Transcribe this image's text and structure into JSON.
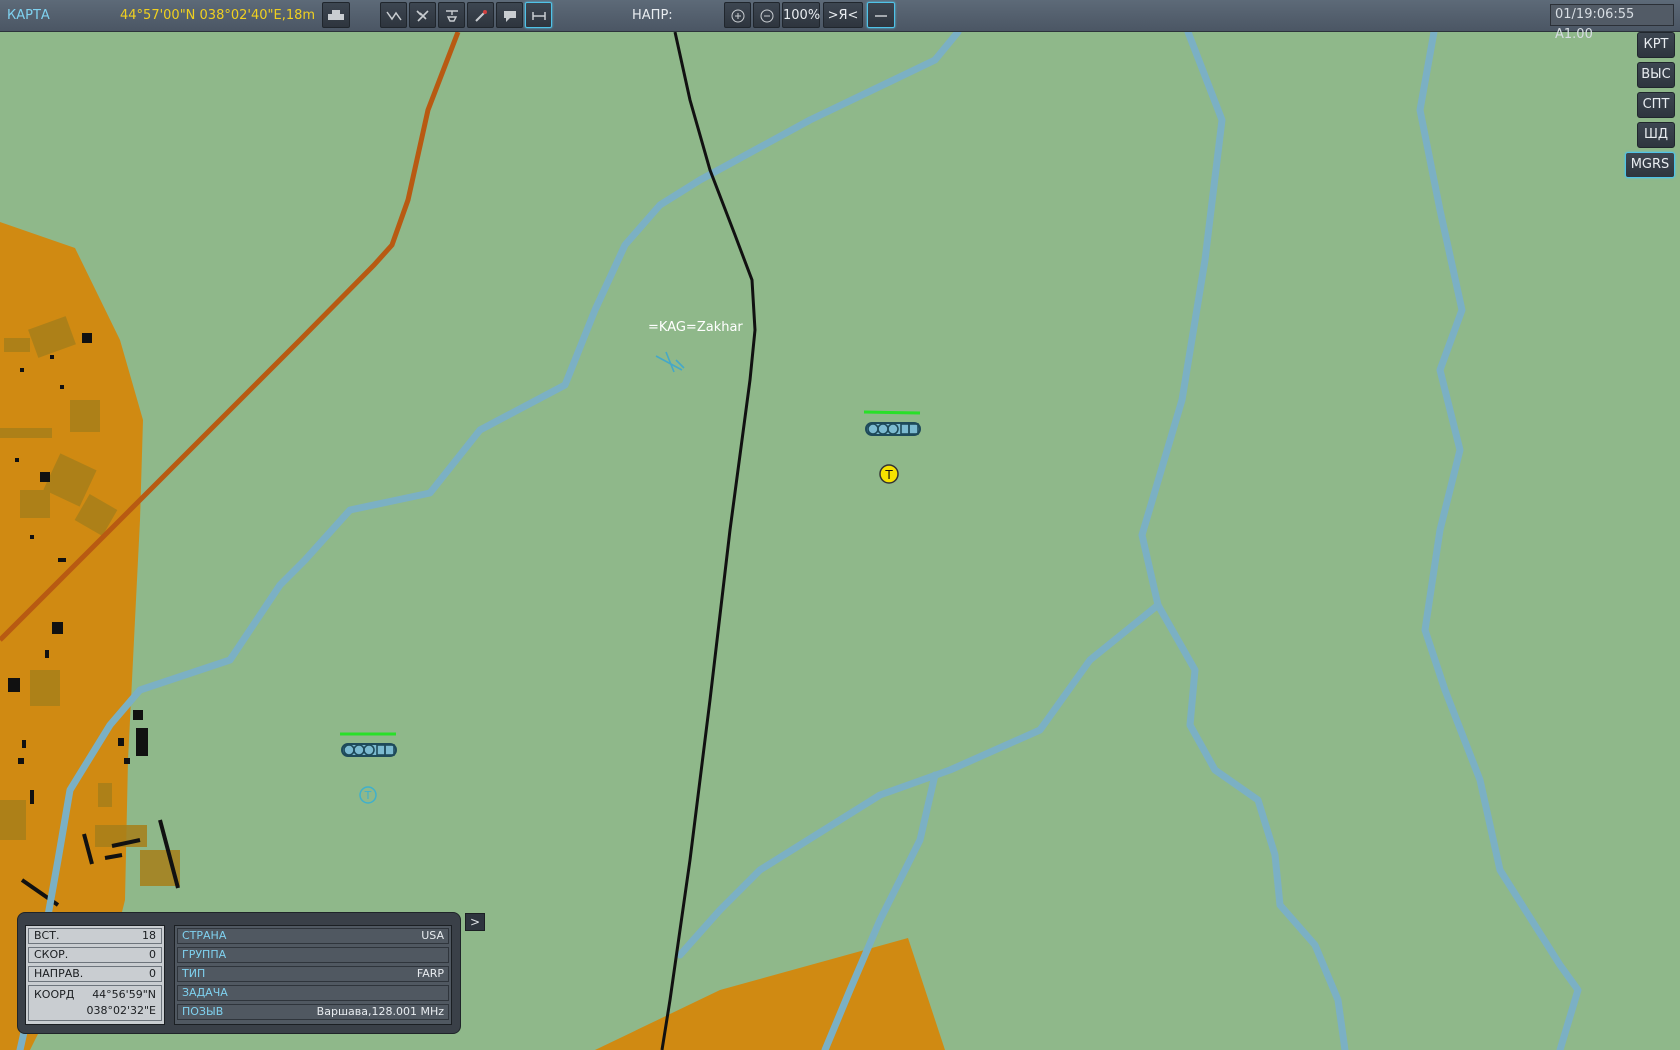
{
  "toolbar": {
    "map_label": "КАРТА",
    "coordinates": "44°57'00\"N 038°02'40\"E,18m",
    "direction_label": "НАПР:",
    "zoom_level": "100%",
    "center_self_label": ">Я<",
    "time_display": "01/19:06:55 A1.00",
    "icons": [
      "vehicle-icon",
      "route-icon",
      "plane-filter-icon",
      "helicopter-filter-icon",
      "sam-filter-icon",
      "message-icon",
      "ruler-icon",
      "zoom-in-icon",
      "zoom-out-icon",
      "line-icon"
    ]
  },
  "right_buttons": [
    {
      "label": "КРТ",
      "active": false
    },
    {
      "label": "ВЫС",
      "active": false
    },
    {
      "label": "СПТ",
      "active": false
    },
    {
      "label": "ШД",
      "active": false
    },
    {
      "label": "MGRS",
      "active": true
    }
  ],
  "map": {
    "unit_label": "=KAG=Zakhar",
    "marker_letter_yellow": "T",
    "marker_letter_cyan": "T"
  },
  "info_panel": {
    "altitude_label": "ВСТ.",
    "altitude_value": "18",
    "speed_label": "СКОР.",
    "speed_value": "0",
    "heading_label": "НАПРАВ.",
    "heading_value": "0",
    "coord_label": "КООРД",
    "coord_lat": "44°56'59\"N",
    "coord_lon": "038°02'32\"E",
    "country_label": "СТРАНА",
    "country_value": "USA",
    "group_label": "ГРУППА",
    "group_value": "",
    "type_label": "ТИП",
    "type_value": "FARP",
    "task_label": "ЗАДАЧА",
    "task_value": "",
    "callsign_label": "ПОЗЫВ",
    "callsign_value": "Варшава,128.001 MHz",
    "expand_label": ">"
  },
  "colors": {
    "terrain": "#8fb88a",
    "urban": "#d08a12",
    "river": "#7bb0c4",
    "road": "#b85a12",
    "rail": "#111111",
    "accent": "#4fc3e8",
    "coord_text": "#f0d020"
  }
}
